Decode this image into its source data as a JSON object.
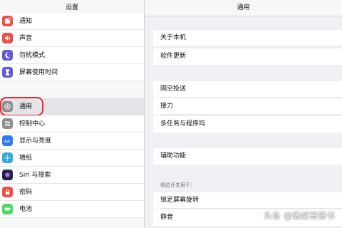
{
  "left": {
    "title": "设置",
    "items": [
      {
        "label": "通知",
        "icon": "notification-icon",
        "color": "#f14b45"
      },
      {
        "label": "声音",
        "icon": "sound-icon",
        "color": "#f14b45"
      },
      {
        "label": "勿扰模式",
        "icon": "moon-icon",
        "color": "#5f5cd6"
      },
      {
        "label": "屏幕使用时间",
        "icon": "hourglass-icon",
        "color": "#5f5cd6"
      },
      {
        "label": "通用",
        "icon": "gear-icon",
        "color": "#8e8e93",
        "selected": true
      },
      {
        "label": "控制中心",
        "icon": "control-center-icon",
        "color": "#8e8e93"
      },
      {
        "label": "显示与亮度",
        "icon": "brightness-icon",
        "color": "#2f7cf6"
      },
      {
        "label": "墙纸",
        "icon": "wallpaper-icon",
        "color": "#35aadc"
      },
      {
        "label": "Siri 与搜索",
        "icon": "siri-icon",
        "color": "#222244"
      },
      {
        "label": "密码",
        "icon": "lock-icon",
        "color": "#f14b45"
      },
      {
        "label": "电池",
        "icon": "battery-icon",
        "color": "#4cd964"
      }
    ]
  },
  "right": {
    "title": "通用",
    "group1": [
      "关于本机",
      "软件更新"
    ],
    "group2": [
      "隔空投送",
      "接力",
      "多任务与程序坞"
    ],
    "group3": [
      "辅助功能"
    ],
    "group4_header": "侧边开关用于：",
    "group4": [
      "锁定屏幕旋转",
      "静音"
    ]
  },
  "watermark": "头条 @情叔哥情书"
}
